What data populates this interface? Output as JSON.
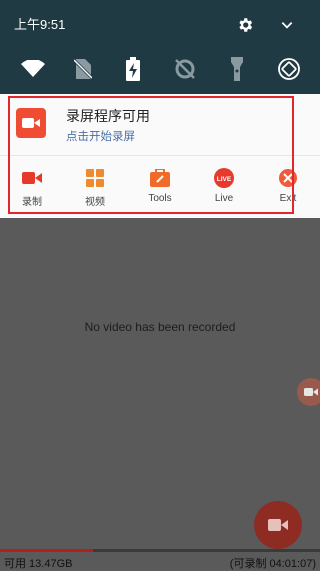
{
  "status_bar": {
    "time": "上午9:51"
  },
  "quick_settings": {
    "tiles": [
      "wifi-icon",
      "no-sim-icon",
      "battery-charging-icon",
      "location-off-icon",
      "flashlight-icon",
      "auto-rotate-icon"
    ]
  },
  "notification": {
    "title": "录屏程序可用",
    "subtitle": "点击开始录屏",
    "actions": [
      {
        "label": "录制",
        "icon": "record-icon"
      },
      {
        "label": "视频",
        "icon": "grid-icon"
      },
      {
        "label": "Tools",
        "icon": "toolbox-icon"
      },
      {
        "label": "Live",
        "icon": "live-icon"
      },
      {
        "label": "Exit",
        "icon": "exit-icon"
      }
    ],
    "live_badge": "LIVE"
  },
  "main": {
    "empty_message": "No video has been recorded"
  },
  "storage": {
    "available": "可用 13.47GB",
    "remaining": "(可录制 04:01:07)",
    "used_fraction": 0.29
  },
  "colors": {
    "accent": "#f04b33",
    "shade_bg": "#1f3a43",
    "highlight_border": "#e0282c"
  }
}
